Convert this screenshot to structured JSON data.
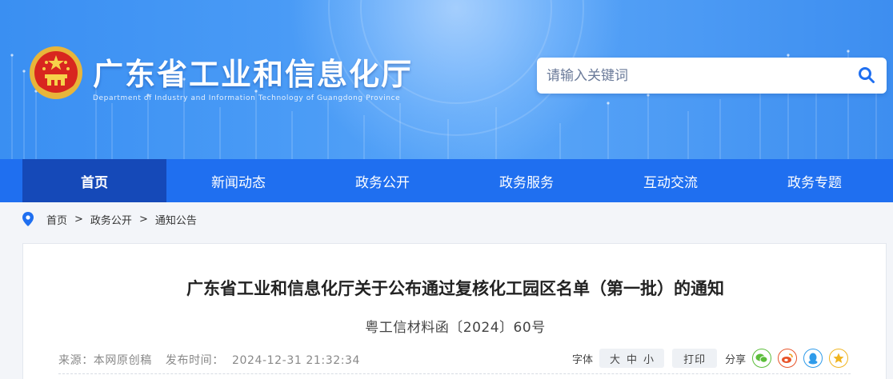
{
  "header": {
    "site_title": "广东省工业和信息化厅",
    "site_subtitle": "Department of Industry and Information Technology of Guangdong Province",
    "search_placeholder": "请输入关键词",
    "search_icon": "search-icon",
    "emblem_icon": "national-emblem-icon"
  },
  "nav": {
    "items": [
      {
        "label": "首页",
        "active": true
      },
      {
        "label": "新闻动态"
      },
      {
        "label": "政务公开"
      },
      {
        "label": "政务服务"
      },
      {
        "label": "互动交流"
      },
      {
        "label": "政务专题"
      }
    ]
  },
  "breadcrumb": {
    "icon": "location-pin-icon",
    "items": [
      "首页",
      "政务公开",
      "通知公告"
    ],
    "separator": ">"
  },
  "article": {
    "title": "广东省工业和信息化厅关于公布通过复核化工园区名单（第一批）的通知",
    "doc_number": "粤工信材料函〔2024〕60号",
    "source": "来源：本网原创稿",
    "published": "发布时间：  2024-12-31 21:32:34",
    "font_label": "字体",
    "font_sizes": [
      "大",
      "中",
      "小"
    ],
    "print_label": "打印",
    "share_label": "分享",
    "share_icons": [
      "wechat-icon",
      "weibo-icon",
      "qq-icon",
      "qzone-star-icon"
    ]
  },
  "colors": {
    "nav_bg": "#1f6ff0",
    "nav_active_bg": "#1549b8",
    "banner_blue": "#3d8ef0"
  }
}
